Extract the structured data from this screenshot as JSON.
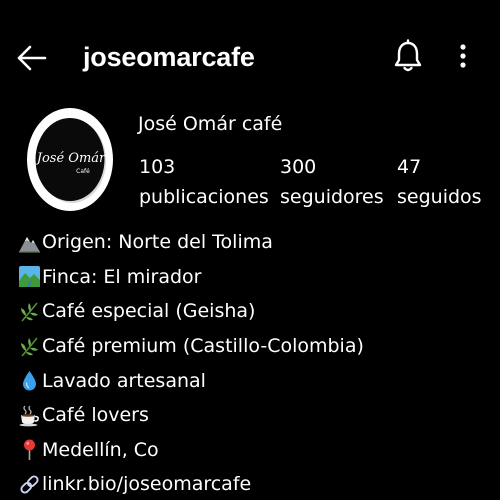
{
  "header": {
    "username": "joseomarcafe",
    "back_icon": "arrow-left-icon",
    "bell_icon": "bell-icon",
    "more_icon": "more-vertical-icon"
  },
  "profile": {
    "display_name": "José Omár café",
    "avatar_text": "José Omár",
    "avatar_subtext": "Café",
    "stats": {
      "posts_count": "103",
      "posts_label": "publicaciones",
      "followers_count": "300",
      "followers_label": "seguidores",
      "following_count": "47",
      "following_label": "seguidos"
    }
  },
  "bio": {
    "lines": [
      {
        "icon": "mountain-icon",
        "text": "Origen: Norte del Tolima"
      },
      {
        "icon": "landscape-icon",
        "text": "Finca: El mirador"
      },
      {
        "icon": "herb-icon",
        "text": "Café especial (Geisha)"
      },
      {
        "icon": "herb-icon",
        "text": "Café premium (Castillo-Colombia)"
      },
      {
        "icon": "droplet-icon",
        "text": "Lavado artesanal"
      },
      {
        "icon": "coffee-cup-icon",
        "text": "Café lovers"
      },
      {
        "icon": "pin-icon",
        "text": "Medellín, Co"
      }
    ],
    "link": {
      "icon": "link-icon",
      "text": "linkr.bio/joseomarcafe"
    }
  },
  "colors": {
    "background": "#000000",
    "text": "#ffffff",
    "link": "#ffffff"
  }
}
